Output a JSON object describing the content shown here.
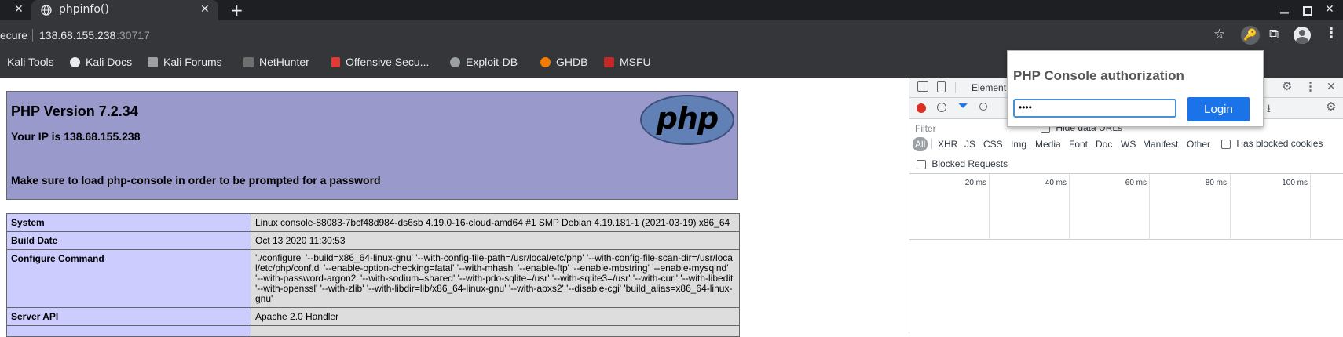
{
  "browser": {
    "tab_title": "phpinfo()",
    "url_prefix": "ecure",
    "url_host": "138.68.155.238",
    "url_port": ":30717",
    "bookmarks": [
      {
        "label": "Kali Tools",
        "color": "#e8eaed"
      },
      {
        "label": "Kali Docs",
        "color": "#d0d0d0"
      },
      {
        "label": "Kali Forums",
        "color": "#9aa0a6"
      },
      {
        "label": "NetHunter",
        "color": "#7a7a7a"
      },
      {
        "label": "Offensive Secu...",
        "color": "#e53935"
      },
      {
        "label": "Exploit-DB",
        "color": "#9aa0a6"
      },
      {
        "label": "GHDB",
        "color": "#f57c00"
      },
      {
        "label": "MSFU",
        "color": "#c62828"
      }
    ]
  },
  "php": {
    "version": "PHP Version 7.2.34",
    "ip_line": "Your IP is 138.68.155.238",
    "notice": "Make sure to load php-console in order to be prompted for a password",
    "logo_text": "php",
    "rows": [
      {
        "key": "System",
        "value": "Linux console-88083-7bcf48d984-ds6sb 4.19.0-16-cloud-amd64 #1 SMP Debian 4.19.181-1 (2021-03-19) x86_64"
      },
      {
        "key": "Build Date",
        "value": "Oct 13 2020 11:30:53"
      },
      {
        "key": "Configure Command",
        "value": "'./configure' '--build=x86_64-linux-gnu' '--with-config-file-path=/usr/local/etc/php' '--with-config-file-scan-dir=/usr/local/etc/php/conf.d' '--enable-option-checking=fatal' '--with-mhash' '--enable-ftp' '--enable-mbstring' '--enable-mysqlnd' '--with-password-argon2' '--with-sodium=shared' '--with-pdo-sqlite=/usr' '--with-sqlite3=/usr' '--with-curl' '--with-libedit' '--with-openssl' '--with-zlib' '--with-libdir=lib/x86_64-linux-gnu' '--with-apxs2' '--disable-cgi' 'build_alias=x86_64-linux-gnu'"
      },
      {
        "key": "Server API",
        "value": "Apache 2.0 Handler"
      }
    ]
  },
  "devtools": {
    "tab_elements": "Element",
    "filter_placeholder": "Filter",
    "hide_data_urls": "Hide data URLs",
    "types": [
      "All",
      "XHR",
      "JS",
      "CSS",
      "Img",
      "Media",
      "Font",
      "Doc",
      "WS",
      "Manifest",
      "Other"
    ],
    "has_blocked_cookies": "Has blocked cookies",
    "blocked_requests": "Blocked Requests",
    "timeline_ticks": [
      "20 ms",
      "40 ms",
      "60 ms",
      "80 ms",
      "100 ms"
    ]
  },
  "popup": {
    "title": "PHP Console authorization",
    "password_value": "••••",
    "login_label": "Login",
    "login_color": "#1a73e8"
  }
}
